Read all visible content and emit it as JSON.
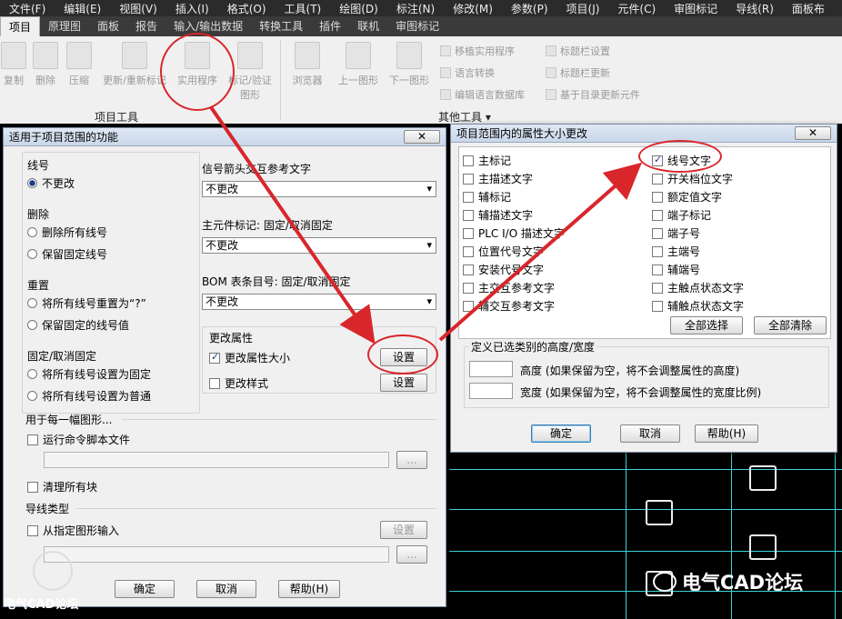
{
  "menubar": [
    "文件(F)",
    "编辑(E)",
    "视图(V)",
    "插入(I)",
    "格式(O)",
    "工具(T)",
    "绘图(D)",
    "标注(N)",
    "修改(M)",
    "参数(P)",
    "项目(J)",
    "元件(C)",
    "审图标记",
    "导线(R)",
    "面板布"
  ],
  "tabs": [
    "项目",
    "原理图",
    "面板",
    "报告",
    "输入/输出数据",
    "转换工具",
    "插件",
    "联机",
    "审图标记"
  ],
  "ribbon": {
    "buttons": [
      "复制",
      "删除",
      "压缩",
      "更新/重新标记",
      "实用程序",
      "标记/验证图形",
      "浏览器",
      "上一图形",
      "下一图形"
    ],
    "small": [
      "移植实用程序",
      "语言转换",
      "编辑语言数据库",
      "标题栏设置",
      "标题栏更新",
      "基于目录更新元件"
    ],
    "group1": "项目工具",
    "group2": "其他工具 ▾"
  },
  "left_dialog": {
    "title": "适用于项目范围的功能",
    "close": "✕",
    "wire_section": "线号",
    "wire_no_change": "不更改",
    "delete_section": "删除",
    "delete_all": "删除所有线号",
    "keep_fixed": "保留固定线号",
    "reset_section": "重置",
    "reset_all": "将所有线号重置为“?”",
    "keep_fixed_value": "保留固定的线号值",
    "fix_section": "固定/取消固定",
    "set_fixed": "将所有线号设置为固定",
    "set_normal": "将所有线号设置为普通",
    "signal_label": "信号箭头交互参考文字",
    "signal_value": "不更改",
    "component_label": "主元件标记: 固定/取消固定",
    "component_value": "不更改",
    "bom_label": "BOM 表条目号: 固定/取消固定",
    "bom_value": "不更改",
    "change_props": "更改属性",
    "change_size": "更改属性大小",
    "change_style": "更改样式",
    "settings1": "设置",
    "settings2": "设置",
    "per_drawing": "用于每一幅图形...",
    "run_script": "运行命令脚本文件",
    "browse1": "...",
    "purge_blocks": "清理所有块",
    "wire_type_section": "导线类型",
    "from_drawing": "从指定图形输入",
    "settings3": "设置",
    "browse2": "...",
    "ok": "确定",
    "cancel": "取消",
    "help": "帮助(H)"
  },
  "right_dialog": {
    "title": "项目范围内的属性大小更改",
    "close": "✕",
    "left_items": [
      "主标记",
      "主描述文字",
      "辅标记",
      "辅描述文字",
      "PLC I/O 描述文字",
      "位置代号文字",
      "安装代号文字",
      "主交互参考文字",
      "辅交互参考文字"
    ],
    "right_items": [
      "线号文字",
      "开关档位文字",
      "额定值文字",
      "端子标记",
      "端子号",
      "主端号",
      "辅端号",
      "主触点状态文字",
      "辅触点状态文字"
    ],
    "select_all": "全部选择",
    "clear_all": "全部清除",
    "size_section": "定义已选类别的高度/宽度",
    "height_label": "高度 (如果保留为空，将不会调整属性的高度)",
    "width_label": "宽度 (如果保留为空，将不会调整属性的宽度比例)",
    "ok": "确定",
    "cancel": "取消",
    "help": "帮助(H)"
  },
  "watermark": {
    "left_text": "电气CAD论坛",
    "right_text": "电气CAD论坛"
  },
  "colors": {
    "annotation": "#d8262b",
    "cad_line": "#3fd4d9"
  }
}
